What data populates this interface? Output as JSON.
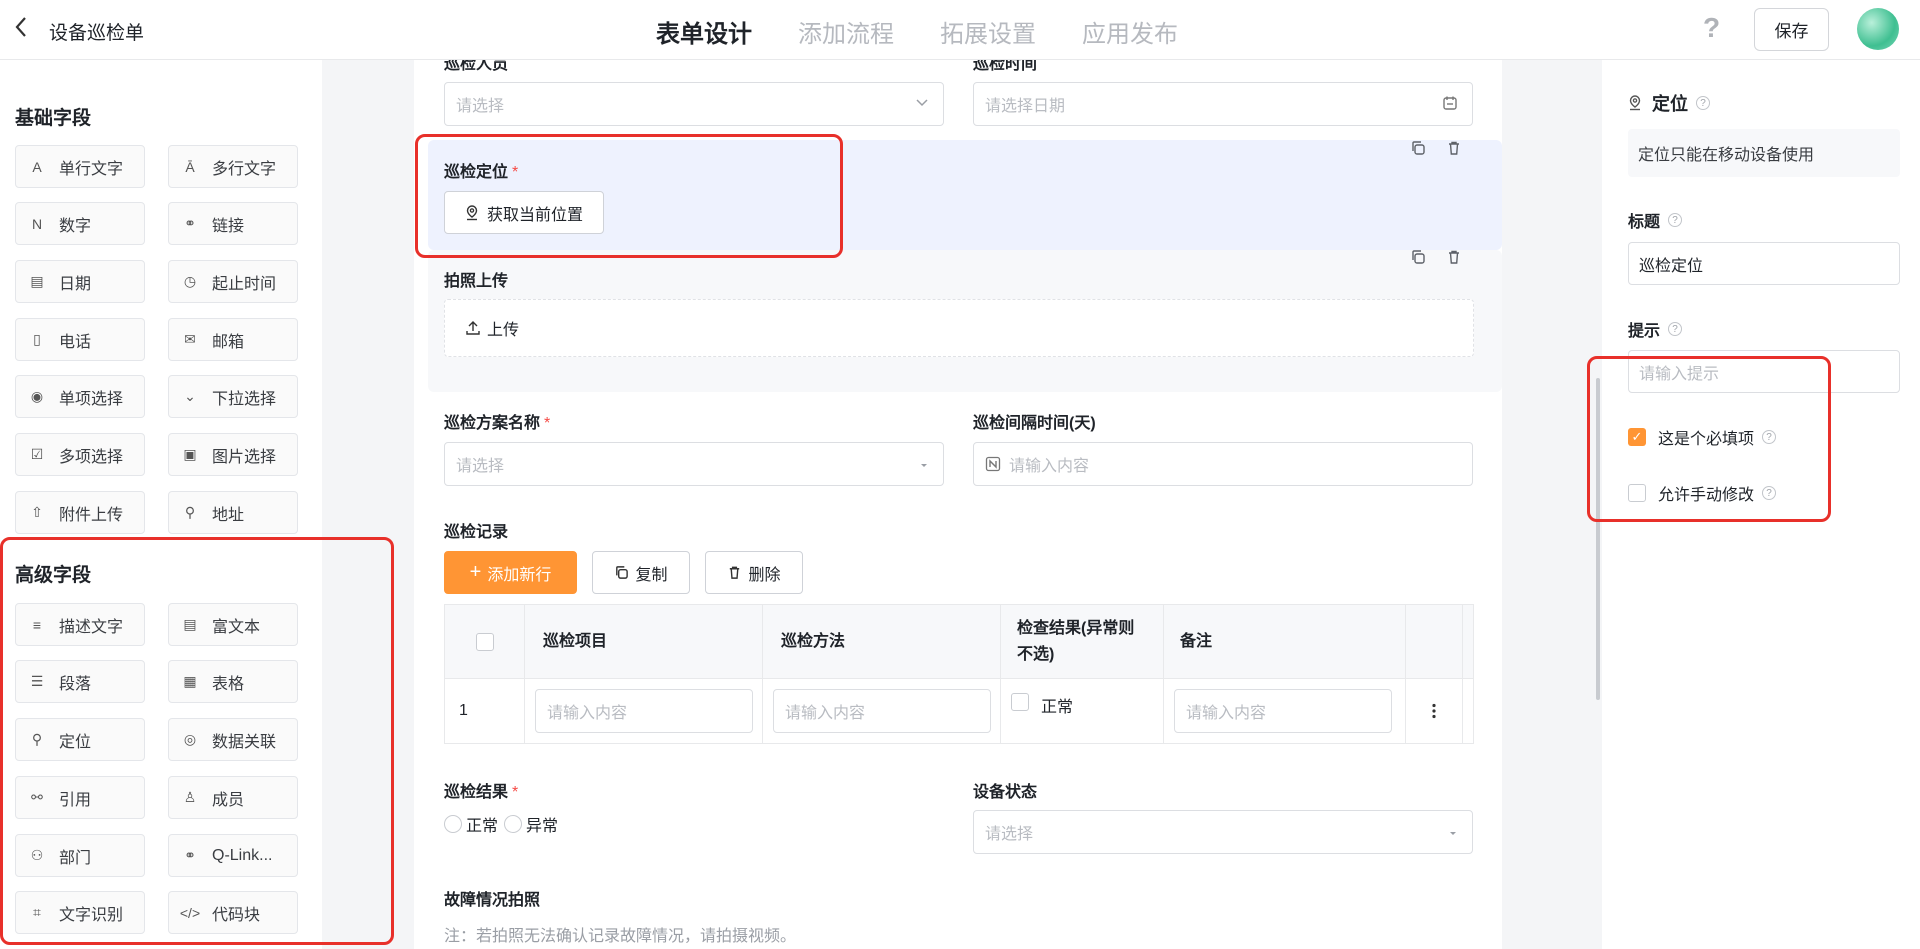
{
  "header": {
    "back_icon": "chevron-left-icon",
    "title": "设备巡检单",
    "tabs": [
      {
        "label": "表单设计",
        "active": true
      },
      {
        "label": "添加流程",
        "active": false
      },
      {
        "label": "拓展设置",
        "active": false
      },
      {
        "label": "应用发布",
        "active": false
      }
    ],
    "help_icon": "question-icon",
    "help_glyph": "?",
    "save_label": "保存"
  },
  "sidebar": {
    "basic_title": "基础字段",
    "basic_fields": [
      {
        "label": "单行文字",
        "icon": "text-line-icon",
        "glyph": "A"
      },
      {
        "label": "多行文字",
        "icon": "text-multiline-icon",
        "glyph": "Ā"
      },
      {
        "label": "数字",
        "icon": "number-icon",
        "glyph": "N"
      },
      {
        "label": "链接",
        "icon": "link-icon",
        "glyph": "⚭"
      },
      {
        "label": "日期",
        "icon": "calendar-icon",
        "glyph": "▤"
      },
      {
        "label": "起止时间",
        "icon": "time-range-icon",
        "glyph": "◷"
      },
      {
        "label": "电话",
        "icon": "phone-icon",
        "glyph": "▯"
      },
      {
        "label": "邮箱",
        "icon": "mail-icon",
        "glyph": "✉"
      },
      {
        "label": "单项选择",
        "icon": "radio-icon",
        "glyph": "◉"
      },
      {
        "label": "下拉选择",
        "icon": "dropdown-icon",
        "glyph": "⌄"
      },
      {
        "label": "多项选择",
        "icon": "checkbox-icon",
        "glyph": "☑"
      },
      {
        "label": "图片选择",
        "icon": "image-icon",
        "glyph": "▣"
      },
      {
        "label": "附件上传",
        "icon": "upload-icon",
        "glyph": "⇧"
      },
      {
        "label": "地址",
        "icon": "address-icon",
        "glyph": "⚲"
      }
    ],
    "advanced_title": "高级字段",
    "advanced_fields": [
      {
        "label": "描述文字",
        "icon": "description-icon",
        "glyph": "≡"
      },
      {
        "label": "富文本",
        "icon": "rich-text-icon",
        "glyph": "▤"
      },
      {
        "label": "段落",
        "icon": "paragraph-icon",
        "glyph": "☰"
      },
      {
        "label": "表格",
        "icon": "table-icon",
        "glyph": "▦"
      },
      {
        "label": "定位",
        "icon": "location-icon",
        "glyph": "⚲"
      },
      {
        "label": "数据关联",
        "icon": "data-link-icon",
        "glyph": "◎"
      },
      {
        "label": "引用",
        "icon": "reference-icon",
        "glyph": "⚯"
      },
      {
        "label": "成员",
        "icon": "member-icon",
        "glyph": "♙"
      },
      {
        "label": "部门",
        "icon": "department-icon",
        "glyph": "⚇"
      },
      {
        "label": "Q-Link...",
        "icon": "qlink-icon",
        "glyph": "⚭"
      },
      {
        "label": "文字识别",
        "icon": "ocr-icon",
        "glyph": "⌗"
      },
      {
        "label": "代码块",
        "icon": "code-icon",
        "glyph": "</>"
      }
    ]
  },
  "form": {
    "partial_top_left_label": "巡检人员",
    "partial_top_right_label": "巡检时间",
    "top_left_placeholder": "请选择",
    "top_right_placeholder": "请选择日期",
    "location_label": "巡检定位",
    "location_button": "获取当前位置",
    "photo_label": "拍照上传",
    "upload_label": "上传",
    "plan_label": "巡检方案名称",
    "plan_placeholder": "请选择",
    "interval_label": "巡检间隔时间(天)",
    "interval_placeholder": "请输入内容",
    "record_label": "巡检记录",
    "add_row_button": "添加新行",
    "copy_button": "复制",
    "delete_button": "删除",
    "table_headers": [
      "巡检项目",
      "巡检方法",
      "检查结果(异常则不选)",
      "备注"
    ],
    "table_rows": [
      {
        "index": "1",
        "item_placeholder": "请输入内容",
        "method_placeholder": "请输入内容",
        "result_label": "正常",
        "remark_placeholder": "请输入内容"
      }
    ],
    "result_label": "巡检结果",
    "result_options": [
      "正常",
      "异常"
    ],
    "device_status_label": "设备状态",
    "device_status_placeholder": "请选择",
    "fault_photo_label": "故障情况拍照",
    "fault_note": "注：若拍照无法确认记录故障情况，请拍摄视频。",
    "required_mark": "*"
  },
  "properties": {
    "component_title": "定位",
    "component_note": "定位只能在移动设备使用",
    "title_label": "标题",
    "title_value": "巡检定位",
    "hint_label": "提示",
    "hint_placeholder": "请输入提示",
    "required_checkbox_label": "这是个必填项",
    "required_checked": true,
    "manual_edit_label": "允许手动修改",
    "manual_edit_checked": false
  },
  "colors": {
    "accent": "#ff9534",
    "annotation": "#e8302a",
    "selected_card": "#eef2fe",
    "required": "#f54a45"
  }
}
